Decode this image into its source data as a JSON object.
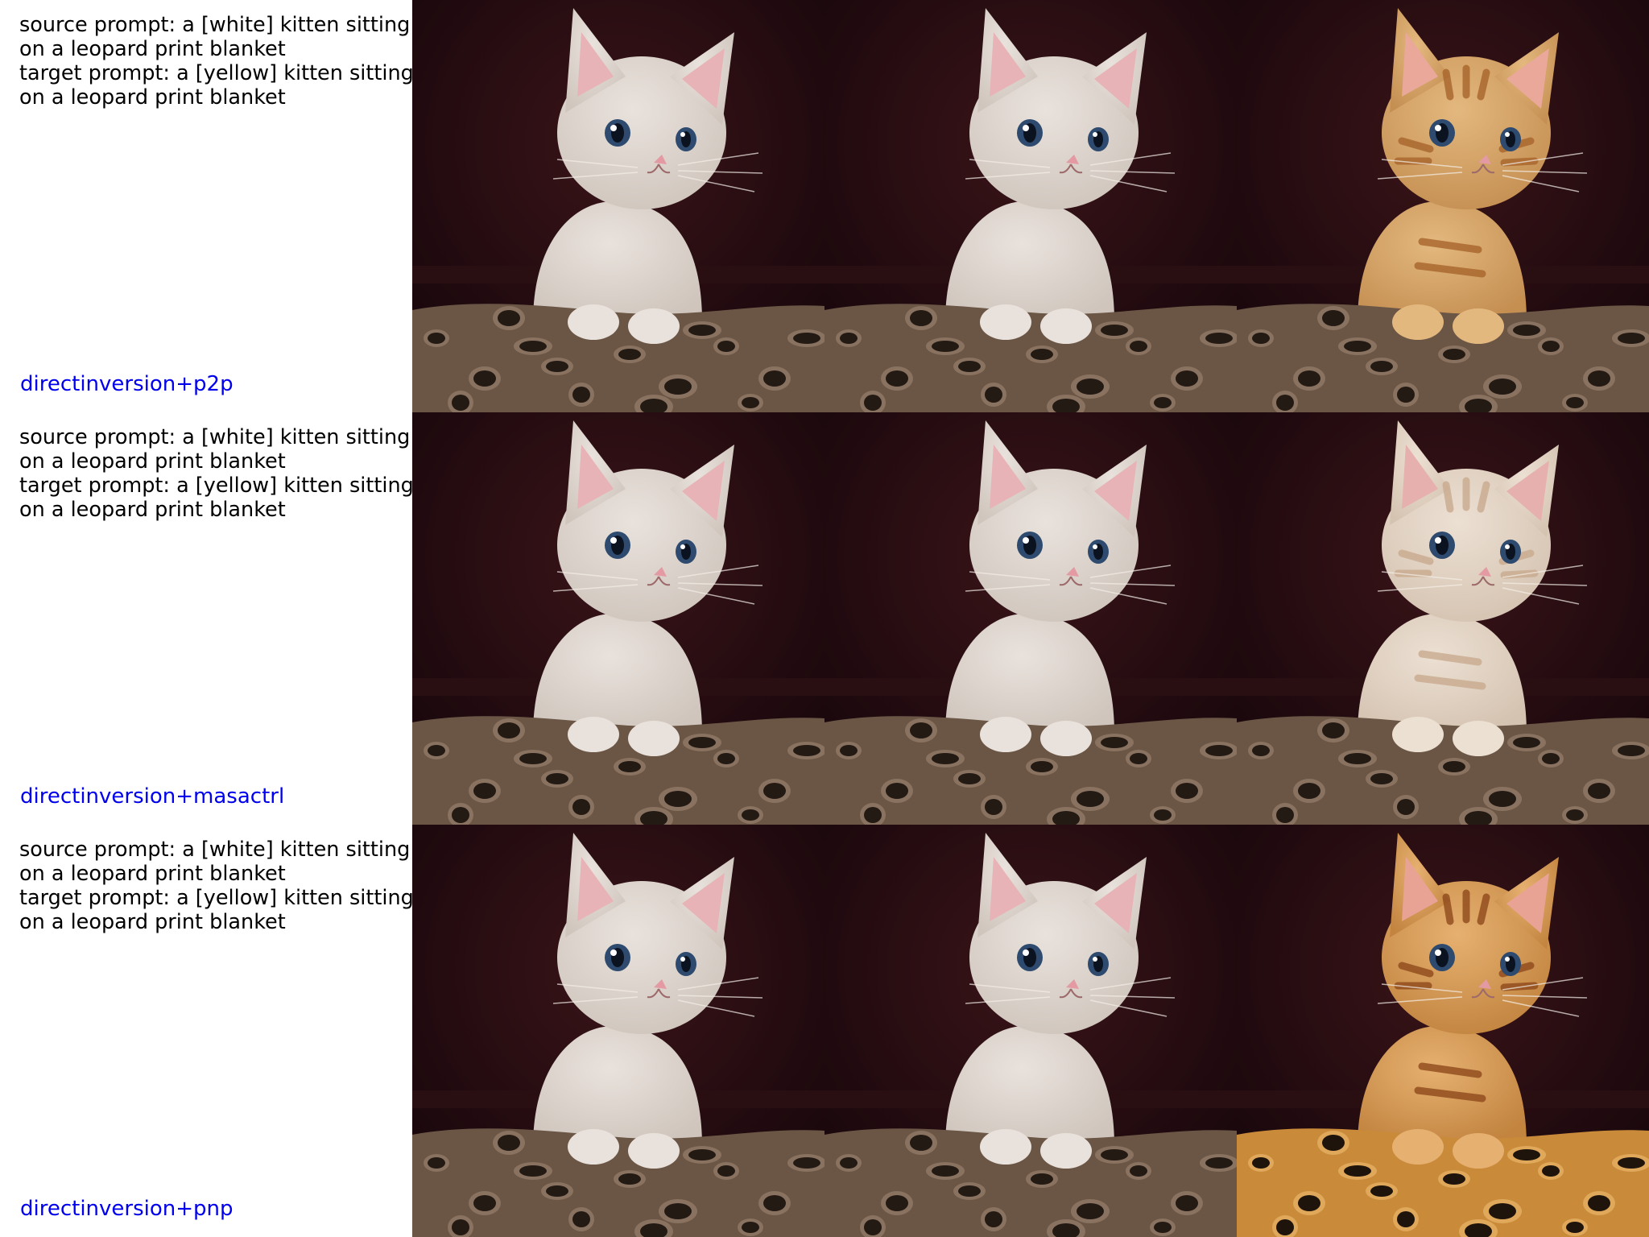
{
  "rows": [
    {
      "prompt_lines": [
        "source prompt: a [white] kitten sitting",
        "on a leopard print blanket",
        "target prompt: a [yellow] kitten sitting",
        "on a leopard print blanket"
      ],
      "method": "directinversion+p2p",
      "images": [
        {
          "kitten": "white",
          "blanket": "dark-leopard"
        },
        {
          "kitten": "white",
          "blanket": "dark-leopard"
        },
        {
          "kitten": "yellow-tabby",
          "blanket": "dark-leopard"
        }
      ]
    },
    {
      "prompt_lines": [
        "source prompt: a [white] kitten sitting",
        "on a leopard print blanket",
        "target prompt: a [yellow] kitten sitting",
        "on a leopard print blanket"
      ],
      "method": "directinversion+masactrl",
      "images": [
        {
          "kitten": "white",
          "blanket": "dark-leopard"
        },
        {
          "kitten": "white",
          "blanket": "dark-leopard"
        },
        {
          "kitten": "cream",
          "blanket": "dark-leopard"
        }
      ]
    },
    {
      "prompt_lines": [
        "source prompt: a [white] kitten sitting",
        "on a leopard print blanket",
        "target prompt: a [yellow] kitten sitting",
        "on a leopard print blanket"
      ],
      "method": "directinversion+pnp",
      "images": [
        {
          "kitten": "white",
          "blanket": "dark-leopard"
        },
        {
          "kitten": "white",
          "blanket": "dark-leopard"
        },
        {
          "kitten": "orange-tabby",
          "blanket": "golden-leopard"
        }
      ]
    }
  ],
  "colors": {
    "method_label": "#0000ee",
    "prompt_text": "#000000",
    "background": "#ffffff"
  }
}
